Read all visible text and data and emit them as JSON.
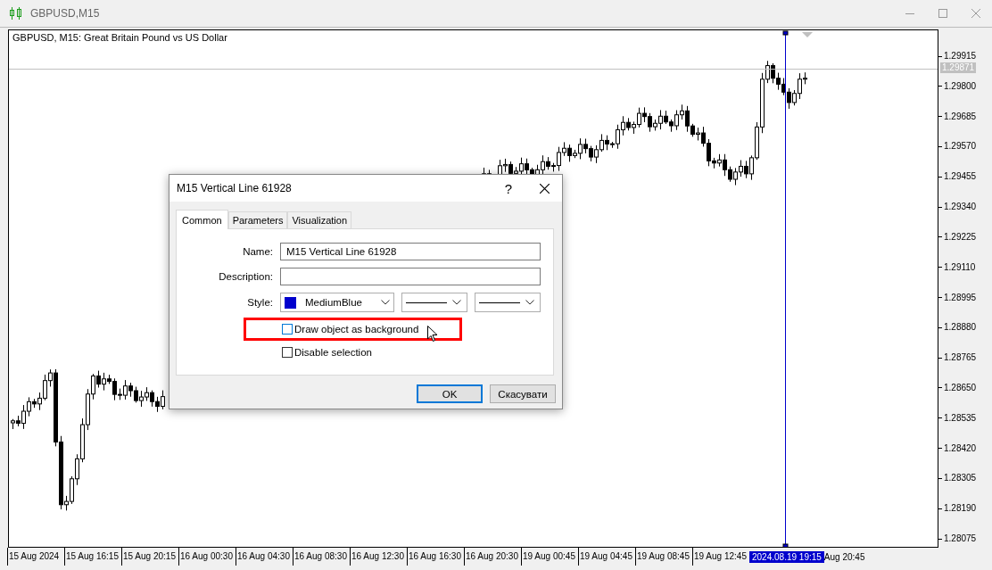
{
  "window": {
    "title": "GBPUSD,M15"
  },
  "chart": {
    "caption": "GBPUSD, M15:  Great Britain Pound vs US Dollar",
    "price_labels": [
      "1.29915",
      "1.29800",
      "1.29685",
      "1.29570",
      "1.29455",
      "1.29340",
      "1.29225",
      "1.29110",
      "1.28995",
      "1.28880",
      "1.28765",
      "1.28650",
      "1.28535",
      "1.28420",
      "1.28305",
      "1.28190",
      "1.28075"
    ],
    "current_price": "1.29871",
    "time_labels": [
      "15 Aug 2024",
      "15 Aug 16:15",
      "15 Aug 20:15",
      "16 Aug 00:30",
      "16 Aug 04:30",
      "16 Aug 08:30",
      "16 Aug 12:30",
      "16 Aug 16:30",
      "16 Aug 20:30",
      "19 Aug 00:45",
      "19 Aug 04:45",
      "19 Aug 08:45",
      "19 Aug 12:45"
    ],
    "cursor_time": "2024.08.19 19:15",
    "time_labels_after": [
      "Aug 20:45"
    ]
  },
  "dialog": {
    "title": "M15 Vertical Line 61928",
    "help": "?",
    "tabs": [
      {
        "label": "Common",
        "selected": true
      },
      {
        "label": "Parameters",
        "selected": false
      },
      {
        "label": "Visualization",
        "selected": false
      }
    ],
    "name": {
      "label": "Name:",
      "value": "M15 Vertical Line 61928"
    },
    "description": {
      "label": "Description:"
    },
    "style": {
      "label": "Style:",
      "color_name": "MediumBlue",
      "color": "#0000cd"
    },
    "checkboxes": [
      {
        "label": "Draw object as background",
        "checked": false,
        "highlighted": true
      },
      {
        "label": "Disable selection",
        "checked": false,
        "highlighted": false
      }
    ],
    "buttons": [
      {
        "label": "OK",
        "default": true
      },
      {
        "label": "Скасувати",
        "default": false
      }
    ]
  }
}
